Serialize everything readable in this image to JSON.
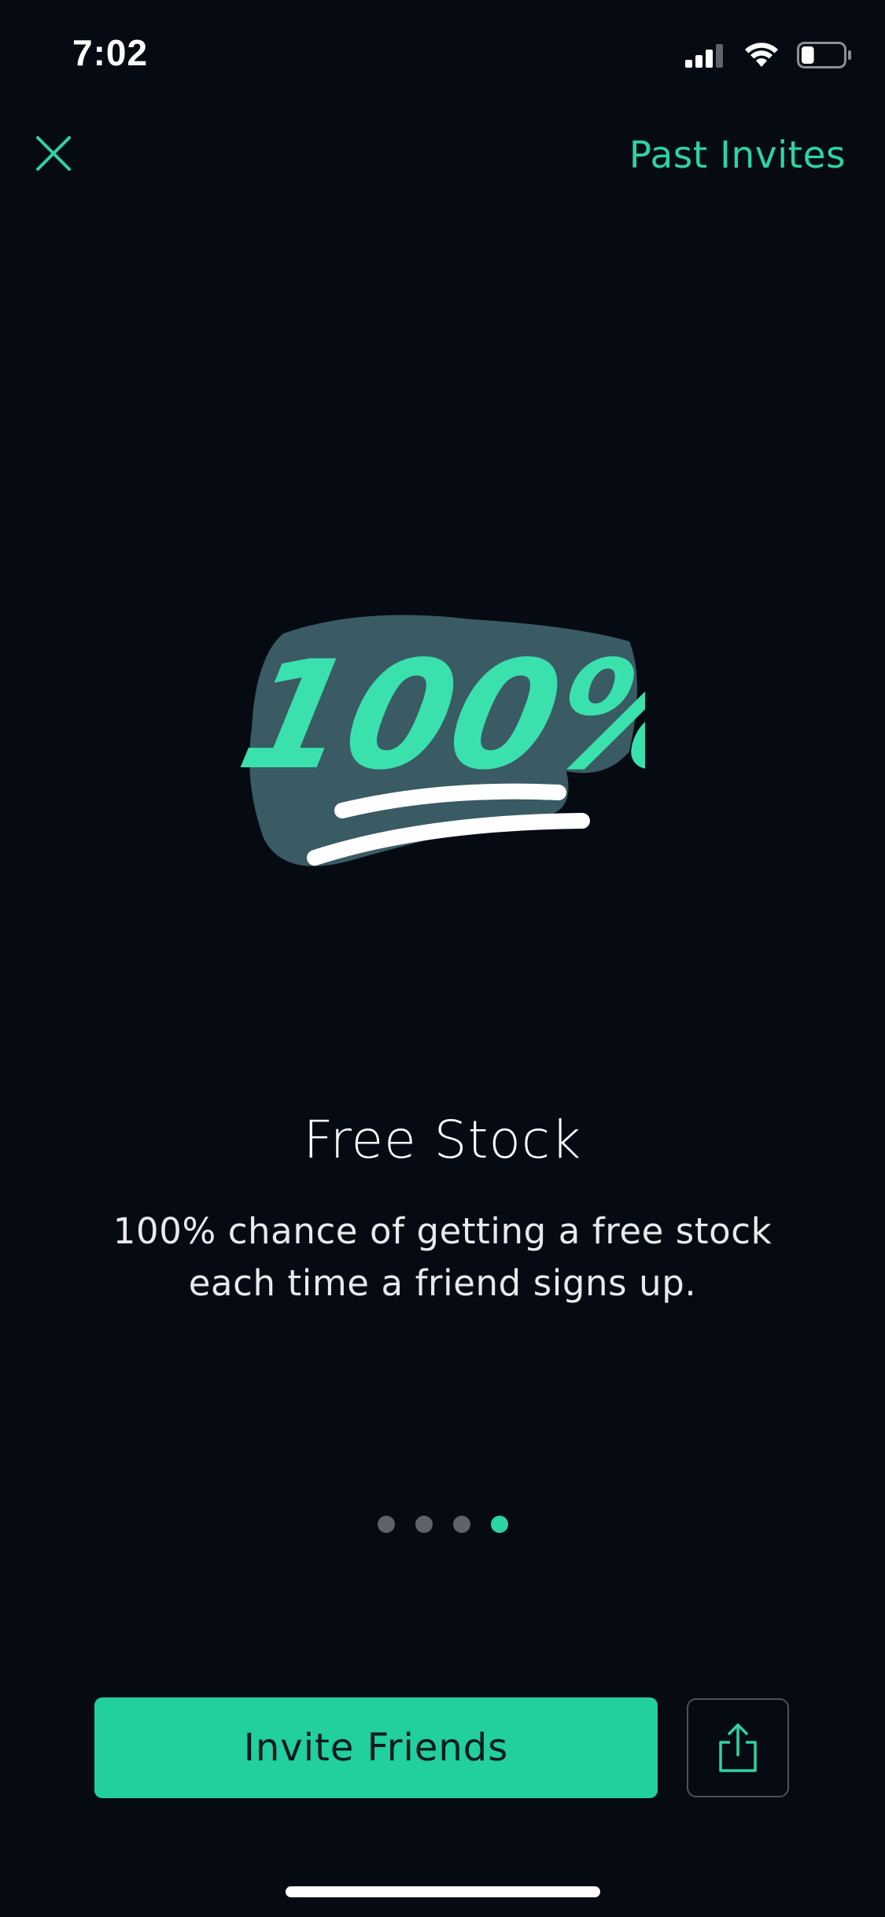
{
  "status_bar": {
    "time": "7:02",
    "signal_icon": "cellular-signal-icon",
    "wifi_icon": "wifi-icon",
    "battery_icon": "battery-icon",
    "battery_level": 0.3
  },
  "nav": {
    "close_icon": "close-icon",
    "past_invites_label": "Past Invites"
  },
  "hero": {
    "emoji": "100%",
    "icon": "hundred-points-icon"
  },
  "content": {
    "title": "Free Stock",
    "subtitle": "100% chance of getting a free stock each time a friend signs up."
  },
  "pager": {
    "page_count": 4,
    "active_index": 3
  },
  "actions": {
    "invite_label": "Invite Friends",
    "share_icon": "share-icon"
  },
  "colors": {
    "background": "#060b13",
    "accent": "#2ed3a3",
    "button": "#21cf9f",
    "inactive_dot": "#5d636a"
  }
}
